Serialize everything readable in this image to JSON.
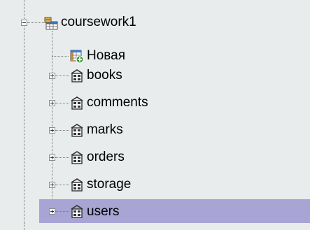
{
  "tree": {
    "root": {
      "label": "coursework1",
      "icon": "database-icon",
      "expanded": true
    },
    "children": [
      {
        "label": "Новая",
        "icon": "new-table-icon",
        "expandable": false
      },
      {
        "label": "books",
        "icon": "table-icon",
        "expandable": true
      },
      {
        "label": "comments",
        "icon": "table-icon",
        "expandable": true
      },
      {
        "label": "marks",
        "icon": "table-icon",
        "expandable": true
      },
      {
        "label": "orders",
        "icon": "table-icon",
        "expandable": true
      },
      {
        "label": "storage",
        "icon": "table-icon",
        "expandable": true
      },
      {
        "label": "users",
        "icon": "table-icon",
        "expandable": true,
        "selected": true
      }
    ]
  },
  "colors": {
    "panel_background": "#e8ecec",
    "selection": "#a8a4d4",
    "connector": "#7a7a7a"
  }
}
